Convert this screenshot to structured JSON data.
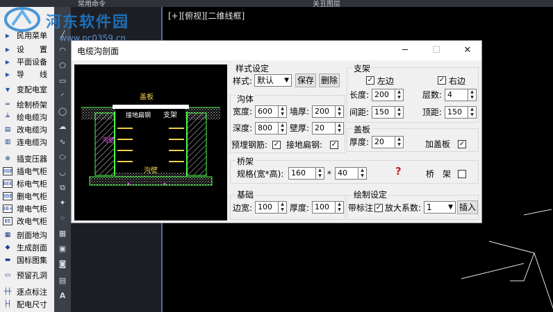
{
  "top_bar": {
    "left_text": "常用命令",
    "center_text": "关丑图层"
  },
  "watermark": {
    "title": "河东软件园",
    "url": "www.pc0359.cn"
  },
  "viewport": {
    "label": "[+][俯视][二维线框]"
  },
  "left_panel": {
    "items": [
      {
        "label": "民用菜单",
        "icon": "triangle-right"
      },
      {
        "label": "设　　置",
        "icon": "triangle-right"
      },
      {
        "label": "平面设备",
        "icon": "triangle-right"
      },
      {
        "label": "导　　线",
        "icon": "triangle-right"
      },
      {
        "label": "变配电室",
        "icon": "triangle-down"
      },
      {
        "label": "绘制桥架",
        "icon": "line"
      },
      {
        "label": "绘电缆沟",
        "icon": "cable-trench"
      },
      {
        "label": "改电缆沟",
        "icon": "cable-trench-edit"
      },
      {
        "label": "连电缆沟",
        "icon": "cable-trench-link"
      },
      {
        "label": "插变压器",
        "icon": "transformer"
      },
      {
        "label": "插电气柜",
        "icon": "cabinet"
      },
      {
        "label": "标电气柜",
        "icon": "cabinet-label"
      },
      {
        "label": "删电气柜",
        "icon": "cabinet-delete"
      },
      {
        "label": "增电气柜",
        "icon": "cabinet-add"
      },
      {
        "label": "改电气柜",
        "icon": "cabinet-edit"
      },
      {
        "label": "剖面地沟",
        "icon": "section"
      },
      {
        "label": "生成剖面",
        "icon": "generate-section"
      },
      {
        "label": "国标图集",
        "icon": "book"
      },
      {
        "label": "预留孔洞",
        "icon": "hole"
      },
      {
        "label": "逐点标注",
        "icon": "point-dim"
      },
      {
        "label": "配电尺寸",
        "icon": "dimension"
      }
    ]
  },
  "dialog": {
    "title": "电缆沟剖面",
    "style_group": {
      "title": "样式设定",
      "style_label": "样式:",
      "style_value": "默认",
      "save_label": "保存",
      "delete_label": "删除"
    },
    "trench_group": {
      "title": "沟体",
      "width_label": "宽度:",
      "width_value": "600",
      "wall_label": "墙厚:",
      "wall_value": "200",
      "depth_label": "深度:",
      "depth_value": "800",
      "wall2_label": "壁厚:",
      "wall2_value": "20",
      "rebar_label": "预埋钢筋:",
      "rebar_checked": true,
      "ground_label": "接地扁钢:",
      "ground_checked": true
    },
    "bracket_group": {
      "title": "支架",
      "left_label": "左边",
      "left_checked": true,
      "right_label": "右边",
      "right_checked": true,
      "length_label": "长度:",
      "length_value": "200",
      "layers_label": "层数:",
      "layers_value": "4",
      "spacing_label": "间距:",
      "spacing_value": "150",
      "top_label": "顶距:",
      "top_value": "150"
    },
    "cover_group": {
      "title": "盖板",
      "thickness_label": "厚度:",
      "thickness_value": "20",
      "add_label": "加盖板",
      "add_checked": true
    },
    "tray_group": {
      "title": "桥架",
      "spec_label": "规格(宽*高):",
      "spec_width": "160",
      "times": "*",
      "spec_height": "40",
      "help": "?",
      "tray_label": "桥　架",
      "tray_checked": false
    },
    "base_group": {
      "title": "基础",
      "edge_label": "边宽:",
      "edge_value": "100",
      "thick_label": "厚度:",
      "thick_value": "100"
    },
    "draw_group": {
      "title": "绘制设定",
      "annot_label": "带标注",
      "annot_checked": true,
      "scale_label": "放大系数:",
      "scale_value": "1",
      "insert_label": "插入"
    },
    "preview": {
      "cover_label": "盖板",
      "ground_label": "接地扁钢",
      "bracket_label": "支架",
      "floor_label": "沟壁",
      "side_label": "沟壁"
    }
  }
}
